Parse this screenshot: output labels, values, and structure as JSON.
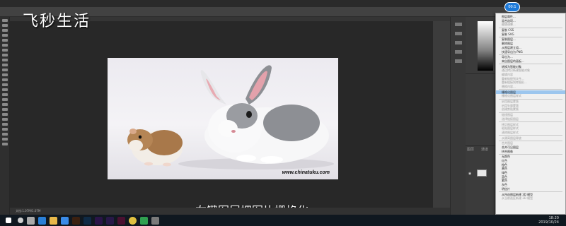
{
  "watermark": {
    "logo_text": "飞秒生活",
    "subtitle": "右键图层把图片栅格化"
  },
  "photo": {
    "url_watermark": "www.chinatuku.com"
  },
  "recorder": {
    "badge": "00:1"
  },
  "menubar": {
    "items": [
      "",
      "",
      "",
      "",
      "",
      "",
      "",
      "",
      "",
      "",
      ""
    ]
  },
  "layers_panel": {
    "tabs": [
      "图层",
      "通道"
    ]
  },
  "statusbar": {
    "text": "文档:1.07M/1.07M"
  },
  "context_menu": {
    "items": [
      {
        "label": "图层属性...",
        "state": "normal"
      },
      {
        "label": "混合选项...",
        "state": "normal"
      },
      {
        "label": "编辑调整...",
        "state": "dim"
      },
      {
        "label": "复制 CSS",
        "state": "normal"
      },
      {
        "label": "复制 SVG",
        "state": "normal"
      },
      {
        "label": "复制图层...",
        "state": "normal"
      },
      {
        "label": "删除图层",
        "state": "normal"
      },
      {
        "label": "从图层建立组...",
        "state": "normal"
      },
      {
        "label": "快速导出为 PNG",
        "state": "normal"
      },
      {
        "label": "导出为...",
        "state": "normal"
      },
      {
        "label": "来自图层的画板...",
        "state": "normal"
      },
      {
        "label": "转换为智能对象",
        "state": "normal"
      },
      {
        "label": "通过拷贝新建智能对象",
        "state": "dim"
      },
      {
        "label": "编辑内容",
        "state": "dim"
      },
      {
        "label": "重新链接到文件...",
        "state": "dim"
      },
      {
        "label": "重新链接到库图形...",
        "state": "dim"
      },
      {
        "label": "替换内容...",
        "state": "dim"
      },
      {
        "label": "栅格化图层",
        "state": "highlight"
      },
      {
        "label": "栅格化图层样式",
        "state": "dim"
      },
      {
        "label": "启用图层蒙版",
        "state": "dim"
      },
      {
        "label": "启用矢量蒙版",
        "state": "dim"
      },
      {
        "label": "创建剪贴蒙版",
        "state": "dim"
      },
      {
        "label": "链接图层",
        "state": "dim"
      },
      {
        "label": "选择链接图层",
        "state": "dim"
      },
      {
        "label": "拷贝图层样式",
        "state": "dim"
      },
      {
        "label": "粘贴图层样式",
        "state": "dim"
      },
      {
        "label": "清除图层样式",
        "state": "dim"
      },
      {
        "label": "从隔离图层释放",
        "state": "dim"
      },
      {
        "label": "合并图层",
        "state": "dim"
      },
      {
        "label": "合并可见图层",
        "state": "normal"
      },
      {
        "label": "拼合图像",
        "state": "normal"
      },
      {
        "label": "无颜色",
        "state": "normal"
      },
      {
        "label": "红色",
        "state": "normal"
      },
      {
        "label": "橙色",
        "state": "normal"
      },
      {
        "label": "黄色",
        "state": "normal"
      },
      {
        "label": "绿色",
        "state": "normal"
      },
      {
        "label": "蓝色",
        "state": "normal"
      },
      {
        "label": "紫色",
        "state": "normal"
      },
      {
        "label": "灰色",
        "state": "normal"
      },
      {
        "label": "明信片",
        "state": "normal"
      },
      {
        "label": "从所选图层新建 3D 模型",
        "state": "normal"
      },
      {
        "label": "从当前选区新建 3D 模型",
        "state": "dim"
      }
    ]
  },
  "taskbar": {
    "time": "18:20",
    "date": "2019/10/24"
  }
}
